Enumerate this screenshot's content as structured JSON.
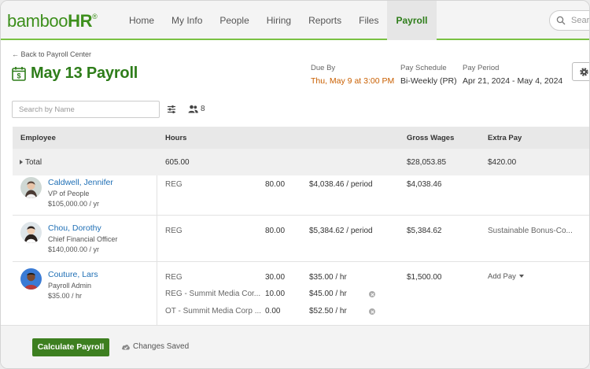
{
  "logo": {
    "text_main": "bamboo",
    "text_hr": "HR",
    "reg": "®"
  },
  "nav": {
    "items": [
      "Home",
      "My Info",
      "People",
      "Hiring",
      "Reports",
      "Files",
      "Payroll"
    ],
    "active": "Payroll",
    "search_placeholder": "Search"
  },
  "header": {
    "back_link": "Back to Payroll Center",
    "title": "May 13 Payroll",
    "due_by_label": "Due By",
    "due_by_value": "Thu, May 9 at 3:00 PM",
    "schedule_label": "Pay Schedule",
    "schedule_value": "Bi-Weekly (PR)",
    "period_label": "Pay Period",
    "period_value": "Apr 21, 2024 - May 4, 2024",
    "accent_color": "#2e7d1a",
    "due_color": "#c95f00"
  },
  "toolbar": {
    "search_placeholder": "Search by Name",
    "employee_count": "8"
  },
  "table": {
    "headers": {
      "employee": "Employee",
      "hours": "Hours",
      "gross": "Gross Wages",
      "extra": "Extra Pay"
    },
    "total": {
      "label": "Total",
      "hours": "605.00",
      "gross": "$28,053.85",
      "extra": "$420.00"
    },
    "employees": [
      {
        "name": "Caldwell, Jennifer",
        "title": "VP of People",
        "pay": "$105,000.00 / yr",
        "lines": [
          {
            "type": "REG",
            "hours": "80.00",
            "rate": "$4,038.46 / period"
          }
        ],
        "gross": "$4,038.46",
        "extra": ""
      },
      {
        "name": "Chou, Dorothy",
        "title": "Chief Financial Officer",
        "pay": "$140,000.00 / yr",
        "lines": [
          {
            "type": "REG",
            "hours": "80.00",
            "rate": "$5,384.62 / period"
          }
        ],
        "gross": "$5,384.62",
        "extra": "Sustainable Bonus-Co..."
      },
      {
        "name": "Couture, Lars",
        "title": "Payroll Admin",
        "pay": "$35.00 / hr",
        "lines": [
          {
            "type": "REG",
            "hours": "30.00",
            "rate": "$35.00 / hr"
          },
          {
            "type": "REG - Summit Media Cor...",
            "hours": "10.00",
            "rate": "$45.00 / hr"
          },
          {
            "type": "OT - Summit Media Corp ...",
            "hours": "0.00",
            "rate": "$52.50 / hr"
          }
        ],
        "gross": "$1,500.00",
        "extra_action": "Add Pay"
      }
    ]
  },
  "footer": {
    "calculate_label": "Calculate Payroll",
    "status": "Changes Saved",
    "button_color": "#3d7f20"
  }
}
